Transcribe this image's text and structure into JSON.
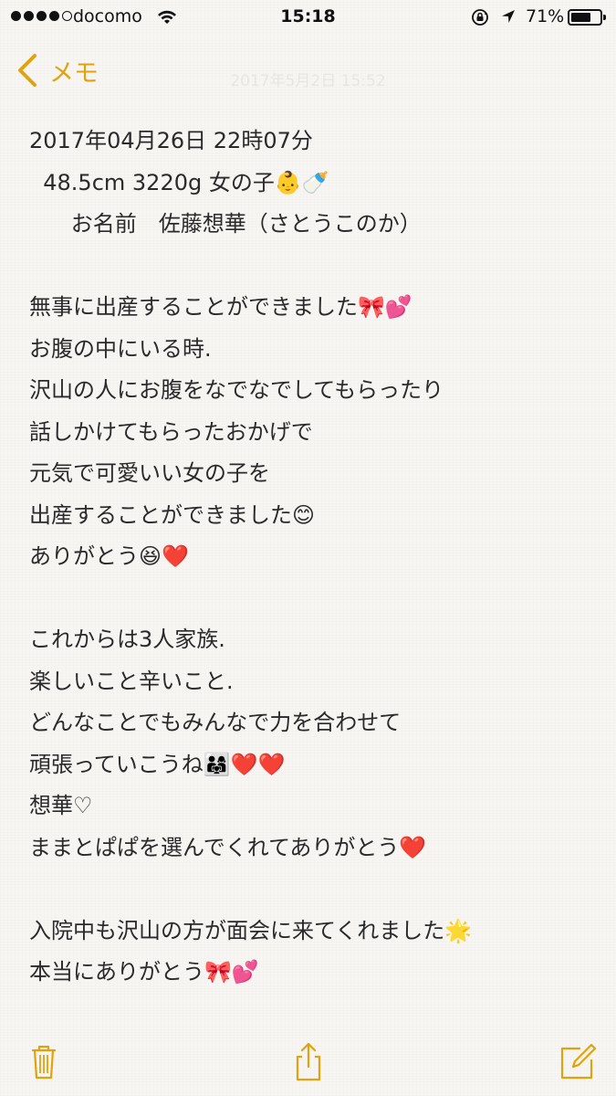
{
  "status_bar": {
    "carrier": "docomo",
    "time": "15:18",
    "battery_percent": "71%",
    "battery_level": 0.71,
    "signal_bars_filled": 4,
    "signal_bars_total": 5
  },
  "nav": {
    "back_label": "メモ",
    "faded_header": "2017年5月2日 15:52"
  },
  "note": {
    "lines": [
      "2017年04月26日 22時07分",
      "  48.5cm 3220g 女の子👶🍼",
      "      お名前　佐藤想華（さとうこのか）",
      "",
      "無事に出産することができました🎀💕",
      "お腹の中にいる時.",
      "沢山の人にお腹をなでなでしてもらったり",
      "話しかけてもらったおかげで",
      "元気で可愛いい女の子を",
      "出産することができました😊",
      "ありがとう😆❤️",
      "",
      "これからは3人家族.",
      "楽しいこと辛いこと.",
      "どんなことでもみんなで力を合わせて",
      "頑張っていこうね👨‍👩‍👧❤️❤️",
      "想華♡",
      "ままとぱぱを選んでくれてありがとう❤️",
      "",
      "入院中も沢山の方が面会に来てくれました🌟",
      "本当にありがとう🎀💕"
    ]
  },
  "toolbar": {
    "icons": [
      "trash-icon",
      "share-icon",
      "compose-icon"
    ]
  },
  "colors": {
    "accent": "#e0a30f",
    "text": "#2a2a2a",
    "paper": "#f7f6f3"
  }
}
